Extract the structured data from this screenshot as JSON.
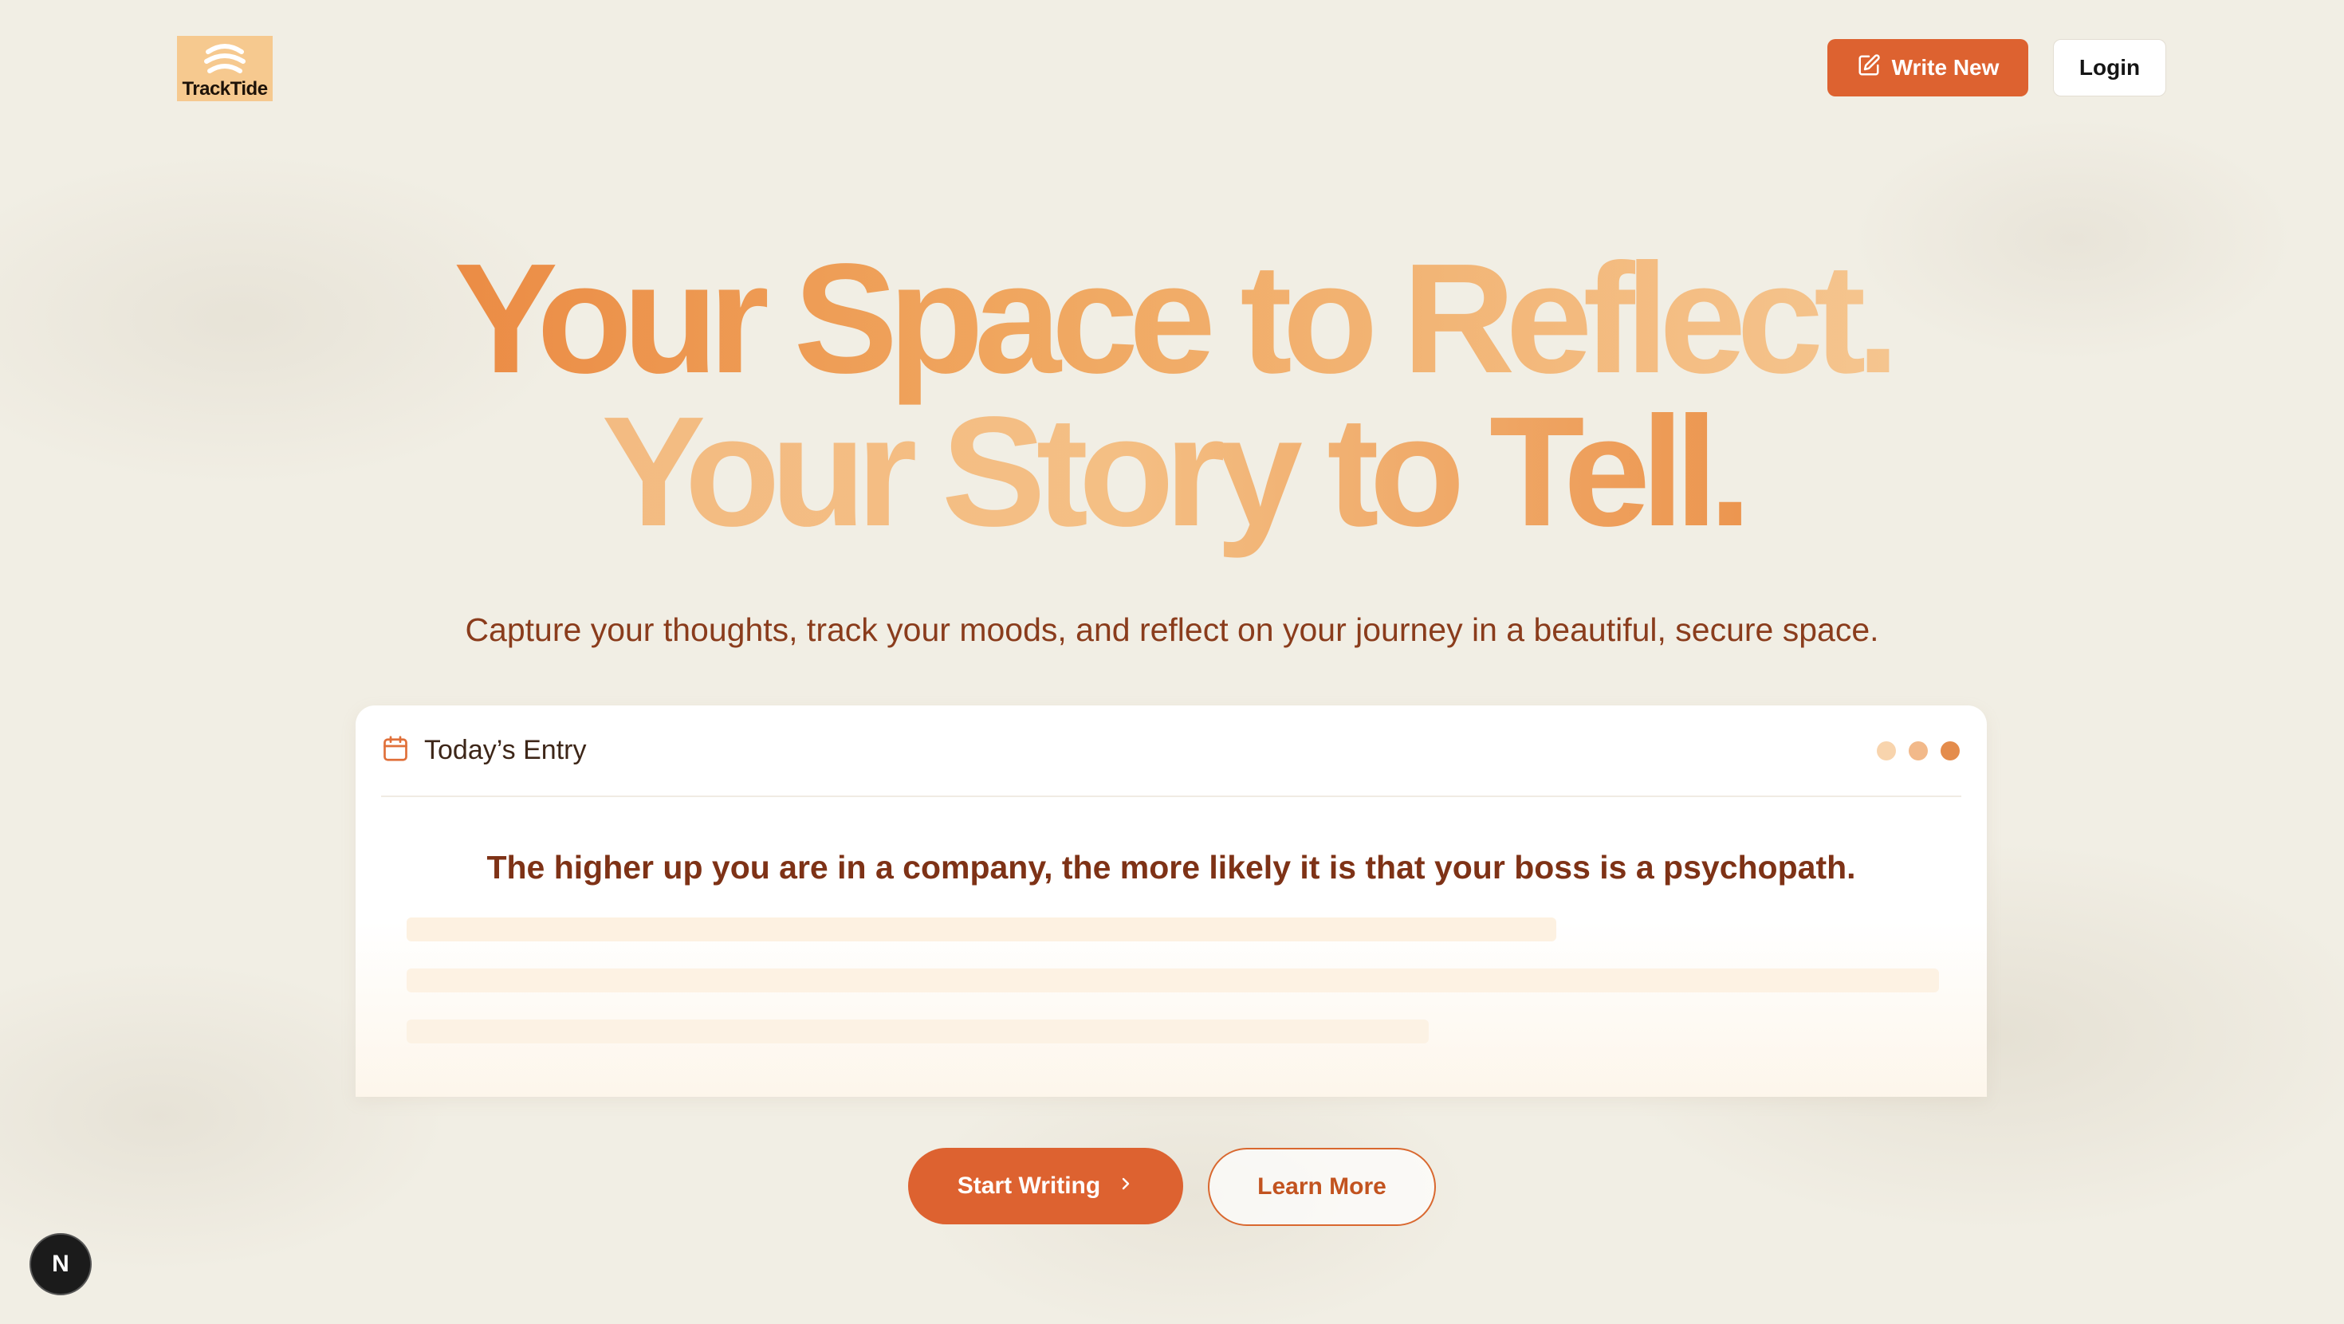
{
  "header": {
    "logo_text": "TrackTide",
    "write_new_label": "Write New",
    "login_label": "Login"
  },
  "hero": {
    "line1": "Your Space to Reflect.",
    "line2": "Your Story to Tell.",
    "subtitle": "Capture your thoughts, track your moods, and reflect on your journey in a beautiful, secure space."
  },
  "entry_card": {
    "title": "Today’s Entry",
    "quote": "The higher up you are in a company, the more likely it is that your boss is a psychopath."
  },
  "cta": {
    "start_label": "Start Writing",
    "learn_label": "Learn More"
  },
  "dev_badge": {
    "letter": "N"
  },
  "icons": {
    "logo": "wave-logo-icon",
    "write": "edit-icon",
    "calendar": "calendar-icon",
    "chevron": "chevron-right-icon"
  },
  "colors": {
    "accent": "#dd6230",
    "accent_text": "#8a3c1c",
    "quote_text": "#7e3216",
    "background": "#f1eee4",
    "logo_bg": "#f6c98f"
  }
}
